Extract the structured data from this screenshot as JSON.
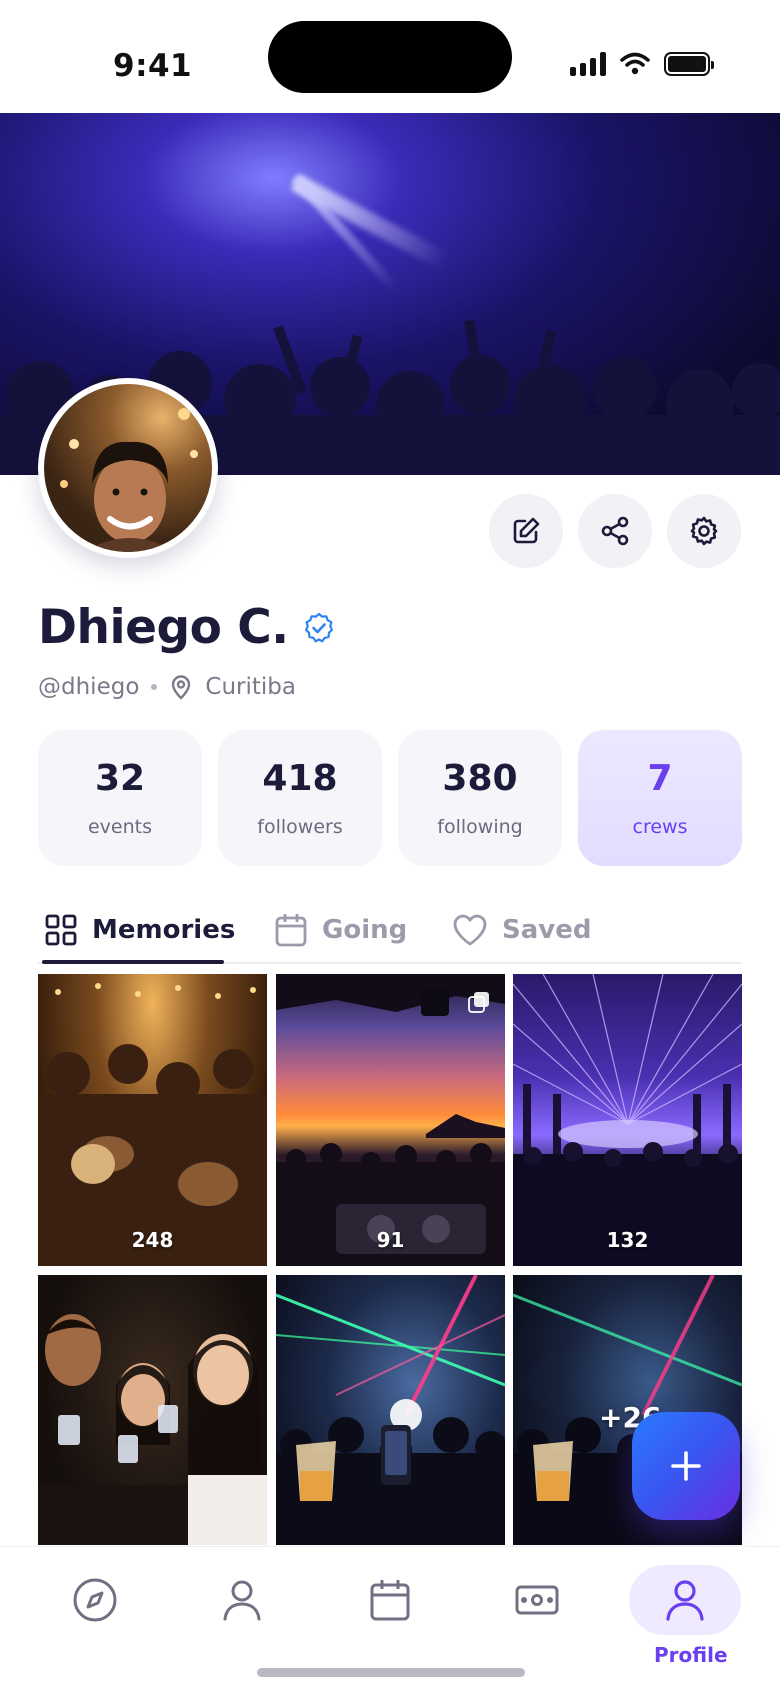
{
  "status_bar": {
    "time": "9:41"
  },
  "profile": {
    "name": "Dhiego C.",
    "handle": "@dhiego",
    "location": "Curitiba",
    "verified": true
  },
  "actions": [
    {
      "icon": "edit-icon"
    },
    {
      "icon": "share-icon"
    },
    {
      "icon": "settings-icon"
    }
  ],
  "stats": [
    {
      "value": "32",
      "label": "events"
    },
    {
      "value": "418",
      "label": "followers"
    },
    {
      "value": "380",
      "label": "following"
    },
    {
      "value": "7",
      "label": "crews",
      "active": true
    }
  ],
  "tabs": [
    {
      "label": "Memories",
      "icon": "grid-icon",
      "active": true
    },
    {
      "label": "Going",
      "icon": "calendar-icon",
      "active": false
    },
    {
      "label": "Saved",
      "icon": "heart-icon",
      "active": false
    }
  ],
  "grid": [
    {
      "count": "248",
      "scene": "street party with guitars"
    },
    {
      "count": "91",
      "scene": "sunset beach DJ set",
      "multi": true
    },
    {
      "count": "132",
      "scene": "purple laser warehouse"
    },
    {
      "count": "",
      "scene": "friends toasting shots"
    },
    {
      "count": "",
      "scene": "laser rave with raised hands"
    },
    {
      "count": "+26",
      "scene": "laser rave with drink"
    }
  ],
  "bottom_nav": [
    {
      "icon": "compass-icon",
      "active": false
    },
    {
      "icon": "person-icon",
      "active": false
    },
    {
      "icon": "calendar-icon",
      "active": false
    },
    {
      "icon": "ticket-icon",
      "active": false
    },
    {
      "icon": "profile-icon",
      "label": "Profile",
      "active": true
    }
  ],
  "colors": {
    "accent": "#6a3ff0",
    "text": "#1c1b3a",
    "muted": "#7a7a8c",
    "verified": "#2d84f0"
  }
}
